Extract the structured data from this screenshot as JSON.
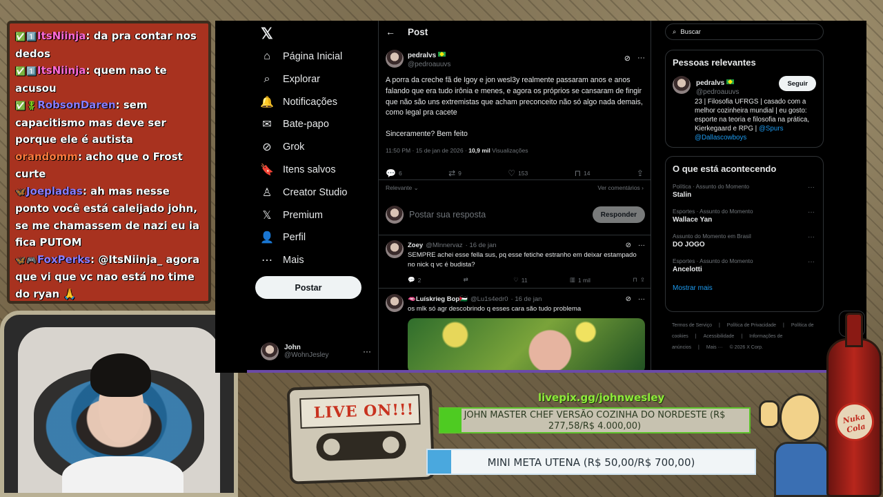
{
  "stream": {
    "chat": [
      {
        "badges": "✅1️⃣",
        "user": "ItsNiinja",
        "user_color": "pink",
        "text": ": da pra contar nos dedos"
      },
      {
        "badges": "✅1️⃣",
        "user": "ItsNiinja",
        "user_color": "pink",
        "text": ": quem nao te acusou"
      },
      {
        "badges": "✅🎖",
        "user": "RobsonDaren",
        "user_color": "blue",
        "text": ": sem capacitismo mas deve ser porque ele é autista"
      },
      {
        "badges": "",
        "user": "orandomm",
        "user_color": "orange",
        "text": ": acho que o Frost curte"
      },
      {
        "badges": "🦋",
        "user": "Joepladas",
        "user_color": "blue",
        "text": ": ah mas nesse ponto você está caleijado john, se me chamassem de nazi eu ia fica PUTOM"
      },
      {
        "badges": "🦋🎮",
        "user": "FoxPerks",
        "user_color": "blue",
        "text": ": @ItsNiinja_ agora que vi que vc nao está no time do ryan 🙏"
      }
    ],
    "livepix": "livepix.gg/johnwesley",
    "goal1": {
      "text": "JOHN MASTER CHEF VERSÃO COZINHA DO NORDESTE (R$ 277,58/R$ 4.000,00)",
      "progress": 0.0694,
      "color": "#4ecb22"
    },
    "goal2": {
      "text": "MINI META UTENA (R$ 50,00/R$ 700,00)",
      "progress": 0.0714,
      "color": "#4aa8de"
    },
    "cassette_label": "LIVE ON!!!",
    "bottle_label": "Nuka Cola"
  },
  "nav": {
    "items": [
      {
        "icon": "home-icon",
        "glyph": "⌂",
        "label": "Página Inicial"
      },
      {
        "icon": "search-icon",
        "glyph": "⌕",
        "label": "Explorar"
      },
      {
        "icon": "bell-icon",
        "glyph": "🔔",
        "label": "Notificações"
      },
      {
        "icon": "mail-icon",
        "glyph": "✉",
        "label": "Bate-papo"
      },
      {
        "icon": "grok-icon",
        "glyph": "⊘",
        "label": "Grok"
      },
      {
        "icon": "bookmark-icon",
        "glyph": "🔖",
        "label": "Itens salvos"
      },
      {
        "icon": "creator-studio-icon",
        "glyph": "♙",
        "label": "Creator Studio"
      },
      {
        "icon": "x-premium-icon",
        "glyph": "𝕏",
        "label": "Premium"
      },
      {
        "icon": "profile-icon",
        "glyph": "👤",
        "label": "Perfil"
      },
      {
        "icon": "more-icon",
        "glyph": "⋯",
        "label": "Mais"
      }
    ],
    "post_label": "Postar",
    "account": {
      "name": "John",
      "handle": "@WohnJesley"
    }
  },
  "main": {
    "title": "Post",
    "tweet": {
      "name": "pedralvs",
      "handle": "@pedroauuvs",
      "body1": "A porra da creche fã de Igoy e jon wesl3y realmente passaram anos e anos falando que era tudo irônia e menes, e agora os próprios se cansaram de fingir que não são uns extremistas que acham preconceito não só algo nada demais, como legal pra cacete",
      "body2": "Sinceramente? Bem feito",
      "time": "11:50 PM · 15 de jan de 2026 · ",
      "views": "10,9 mil",
      "views_label": " Visualizações",
      "replies": "6",
      "reposts": "9",
      "likes": "153",
      "bookmarks": "14"
    },
    "sort_label": "Relevante",
    "see_replies": "Ver comentários",
    "reply_placeholder": "Postar sua resposta",
    "reply_button": "Responder",
    "replies": [
      {
        "name": "Zoey",
        "handle": "@Mlnnervaz",
        "date": "· 16 de jan",
        "text": "SEMPRE achei esse fella sus, pq esse fetiche estranho em deixar estampado no nick q vc é budista?",
        "replies": "2",
        "reposts": "",
        "likes": "11",
        "views": "1 mil"
      },
      {
        "name": "🫦Luískrieg Bop🇵🇸",
        "handle": "@Lu1s4edr0",
        "date": "· 16 de jan",
        "text": "os mlk só agr descobrindo q esses cara são tudo problema"
      }
    ]
  },
  "side": {
    "search_placeholder": "Buscar",
    "relevant_title": "Pessoas relevantes",
    "person": {
      "name": "pedralvs",
      "handle": "@pedroauuvs",
      "follow": "Seguir",
      "bio": "23 | Filosofia UFRGS | casado com a melhor cozinheira mundial | eu gosto: esporte na teoria e filosofia na prática, Kierkegaard e RPG | ",
      "link1": "@Spurs",
      "link2": "@Dallascowboys"
    },
    "trends_title": "O que está acontecendo",
    "trends": [
      {
        "context": "Política · Assunto do Momento",
        "name": "Stalin"
      },
      {
        "context": "Esportes · Assunto do Momento",
        "name": "Wallace Yan"
      },
      {
        "context": "Assunto do Momento em Brasil",
        "name": "DO JOGO"
      },
      {
        "context": "Esportes · Assunto do Momento",
        "name": "Ancelotti"
      }
    ],
    "show_more": "Mostrar mais",
    "footer": [
      "Termos de Serviço",
      "|",
      "Política de Privacidade",
      "|",
      "Política de cookies",
      "|",
      "Acessibilidade",
      "|",
      "Informações de anúncios",
      "|",
      "Mais ···",
      "© 2026 X Corp."
    ]
  }
}
